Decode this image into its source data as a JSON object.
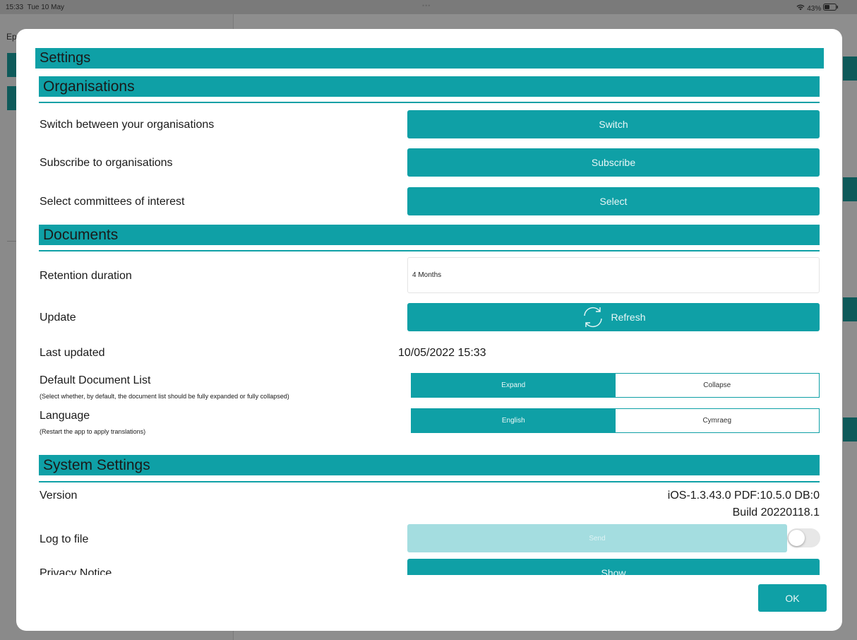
{
  "status_bar": {
    "time": "15:33",
    "date": "Tue 10 May",
    "dots": "•••",
    "battery": "43%"
  },
  "background": {
    "sidebar_title_fragment": "Ep"
  },
  "settings": {
    "title": "Settings",
    "organisations": {
      "header": "Organisations",
      "switch": {
        "label": "Switch between your organisations",
        "button": "Switch"
      },
      "subscribe": {
        "label": "Subscribe to organisations",
        "button": "Subscribe"
      },
      "select": {
        "label": "Select committees of interest",
        "button": "Select"
      }
    },
    "documents": {
      "header": "Documents",
      "retention": {
        "label": "Retention duration",
        "value": "4 Months"
      },
      "update": {
        "label": "Update",
        "button": "Refresh",
        "icon": "refresh-icon"
      },
      "last_updated": {
        "label": "Last updated",
        "value": "10/05/2022 15:33"
      },
      "default_list": {
        "label": "Default Document List",
        "sub": "(Select whether, by default, the document list should be fully expanded or fully collapsed)",
        "options": [
          "Expand",
          "Collapse"
        ],
        "selected": "Expand"
      },
      "language": {
        "label": "Language",
        "sub": "(Restart the app to apply translations)",
        "options": [
          "English",
          "Cymraeg"
        ],
        "selected": "English"
      }
    },
    "system": {
      "header": "System Settings",
      "version": {
        "label": "Version",
        "value": "iOS-1.3.43.0 PDF:10.5.0 DB:0",
        "build": "Build 20220118.1"
      },
      "log": {
        "label": "Log to file",
        "button": "Send",
        "toggle_on": false
      },
      "privacy": {
        "label": "Privacy Notice",
        "button": "Show"
      }
    },
    "ok_label": "OK"
  },
  "colors": {
    "accent": "#0fa0a6",
    "accent_disabled": "#a4dde0"
  }
}
